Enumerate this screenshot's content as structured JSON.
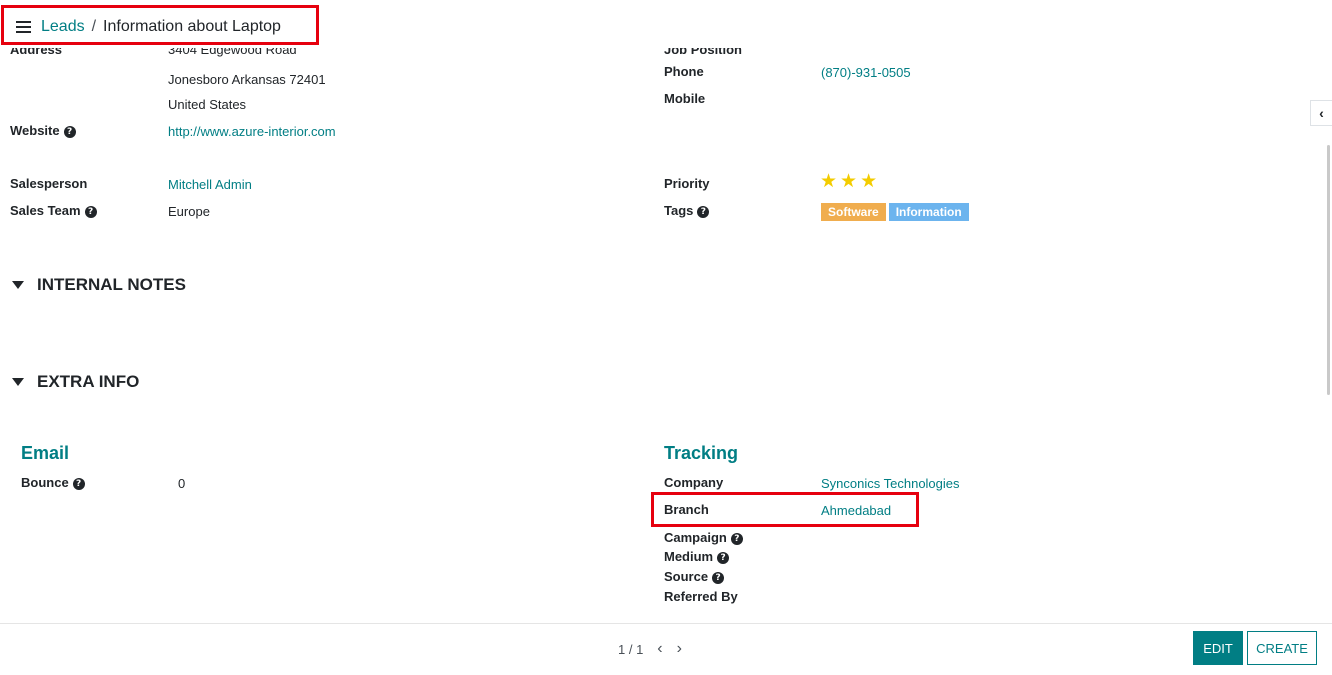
{
  "breadcrumb": {
    "parent": "Leads",
    "separator": "/",
    "current": "Information about Laptop"
  },
  "contact": {
    "address_label": "Address",
    "address_lines": [
      "3404 Edgewood Road",
      "Jonesboro  Arkansas  72401",
      "United States"
    ],
    "website_label": "Website",
    "website_value": "http://www.azure-interior.com",
    "salesperson_label": "Salesperson",
    "salesperson_value": "Mitchell Admin",
    "sales_team_label": "Sales Team",
    "sales_team_value": "Europe"
  },
  "right_info": {
    "job_position_label": "Job Position",
    "phone_label": "Phone",
    "phone_value": "(870)-931-0505",
    "mobile_label": "Mobile",
    "priority_label": "Priority",
    "priority_value": 3,
    "tags_label": "Tags",
    "tags": [
      {
        "label": "Software",
        "color": "#f0ad4e"
      },
      {
        "label": "Information",
        "color": "#6cb4ee"
      }
    ]
  },
  "sections": {
    "internal_notes": "INTERNAL NOTES",
    "extra_info": "EXTRA INFO"
  },
  "email_group": {
    "title": "Email",
    "bounce_label": "Bounce",
    "bounce_value": "0"
  },
  "tracking_group": {
    "title": "Tracking",
    "company_label": "Company",
    "company_value": "Synconics Technologies",
    "branch_label": "Branch",
    "branch_value": "Ahmedabad",
    "campaign_label": "Campaign",
    "medium_label": "Medium",
    "source_label": "Source",
    "referred_by_label": "Referred By"
  },
  "pager": {
    "text": "1 / 1"
  },
  "buttons": {
    "edit": "EDIT",
    "create": "CREATE"
  },
  "icons": {
    "help": "question-circle-icon",
    "menu": "hamburger-icon",
    "star": "star-icon"
  },
  "colors": {
    "accent": "#017e84",
    "highlight_box": "#e6000e",
    "star": "#f3cc00"
  }
}
